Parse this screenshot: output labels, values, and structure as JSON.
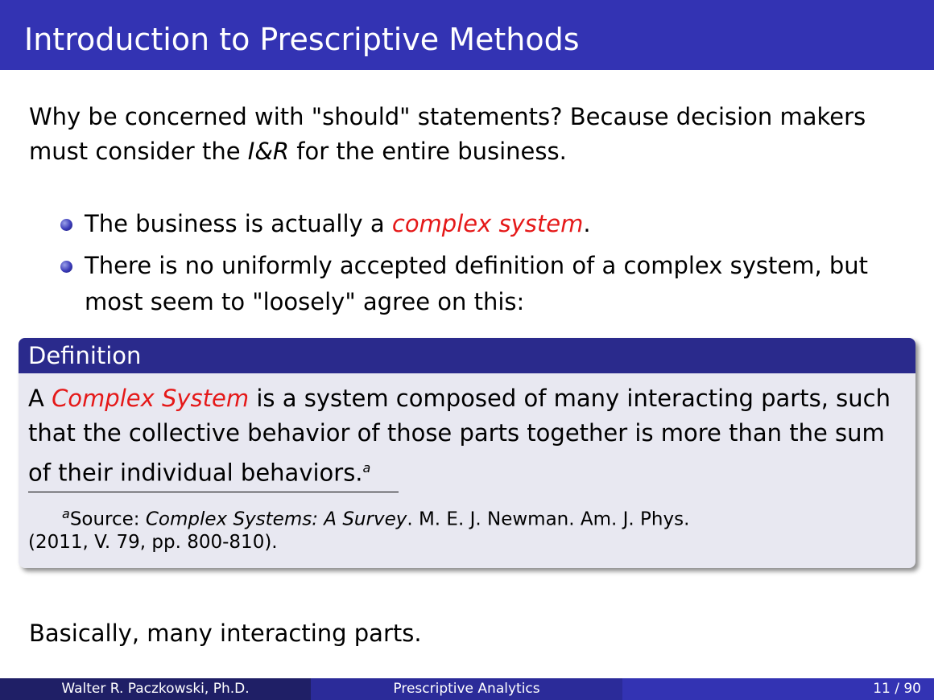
{
  "slide": {
    "title": "Introduction to Prescriptive Methods",
    "intro": {
      "line1": "Why be concerned with \"should\" statements? Because decision makers",
      "line2_pre": "must consider the ",
      "line2_em": "I&R",
      "line2_post": " for the entire business."
    },
    "bullets": [
      {
        "pre": "The business is actually a ",
        "em": "complex system",
        "post": "."
      },
      {
        "line1": "There is no uniformly accepted definition of a complex system, but",
        "line2": "most seem to \"loosely\" agree on this:"
      }
    ],
    "definition": {
      "title": "Definition",
      "line1_pre": "A ",
      "line1_em": "Complex System",
      "line1_post": " is a system composed of many interacting parts, such",
      "line2": "that the collective behavior of those parts together is more than the sum",
      "line3": "of their individual behaviors.",
      "footnote_mark": "a",
      "footnote_pre": "Source: ",
      "footnote_em": "Complex Systems: A Survey",
      "footnote_post": ". M. E. J. Newman. Am. J. Phys.",
      "footnote_line2": "(2011, V. 79, pp. 800-810)."
    },
    "closing": "Basically, many interacting parts."
  },
  "footer": {
    "author": "Walter R. Paczkowski, Ph.D.",
    "course": "Prescriptive Analytics",
    "page": "11 / 90"
  },
  "colors": {
    "title_bar": "#3333b3",
    "accent": "#e51919",
    "block_header": "#2a2a8c",
    "block_body": "#e8e8f1"
  }
}
